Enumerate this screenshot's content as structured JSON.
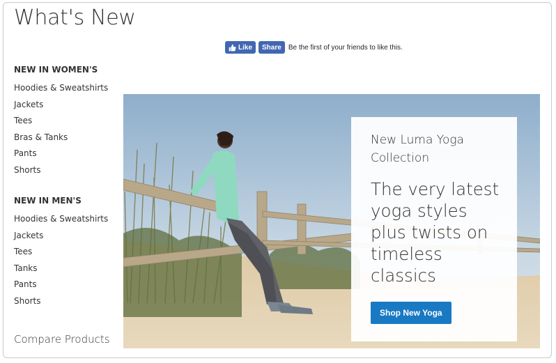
{
  "page": {
    "title": "What's New"
  },
  "social": {
    "like_label": "Like",
    "share_label": "Share",
    "friends_text": "Be the first of your friends to like this.",
    "brand_color": "#4267b2"
  },
  "sidebar": {
    "women": {
      "heading": "NEW IN WOMEN'S",
      "items": [
        "Hoodies & Sweatshirts",
        "Jackets",
        "Tees",
        "Bras & Tanks",
        "Pants",
        "Shorts"
      ]
    },
    "men": {
      "heading": "NEW IN MEN'S",
      "items": [
        "Hoodies & Sweatshirts",
        "Jackets",
        "Tees",
        "Tanks",
        "Pants",
        "Shorts"
      ]
    },
    "compare_label": "Compare Products"
  },
  "hero": {
    "subtitle": "New Luma Yoga Collection",
    "headline": "The very latest yoga styles plus twists on timeless classics",
    "button_label": "Shop New Yoga",
    "button_color": "#1979c3"
  }
}
